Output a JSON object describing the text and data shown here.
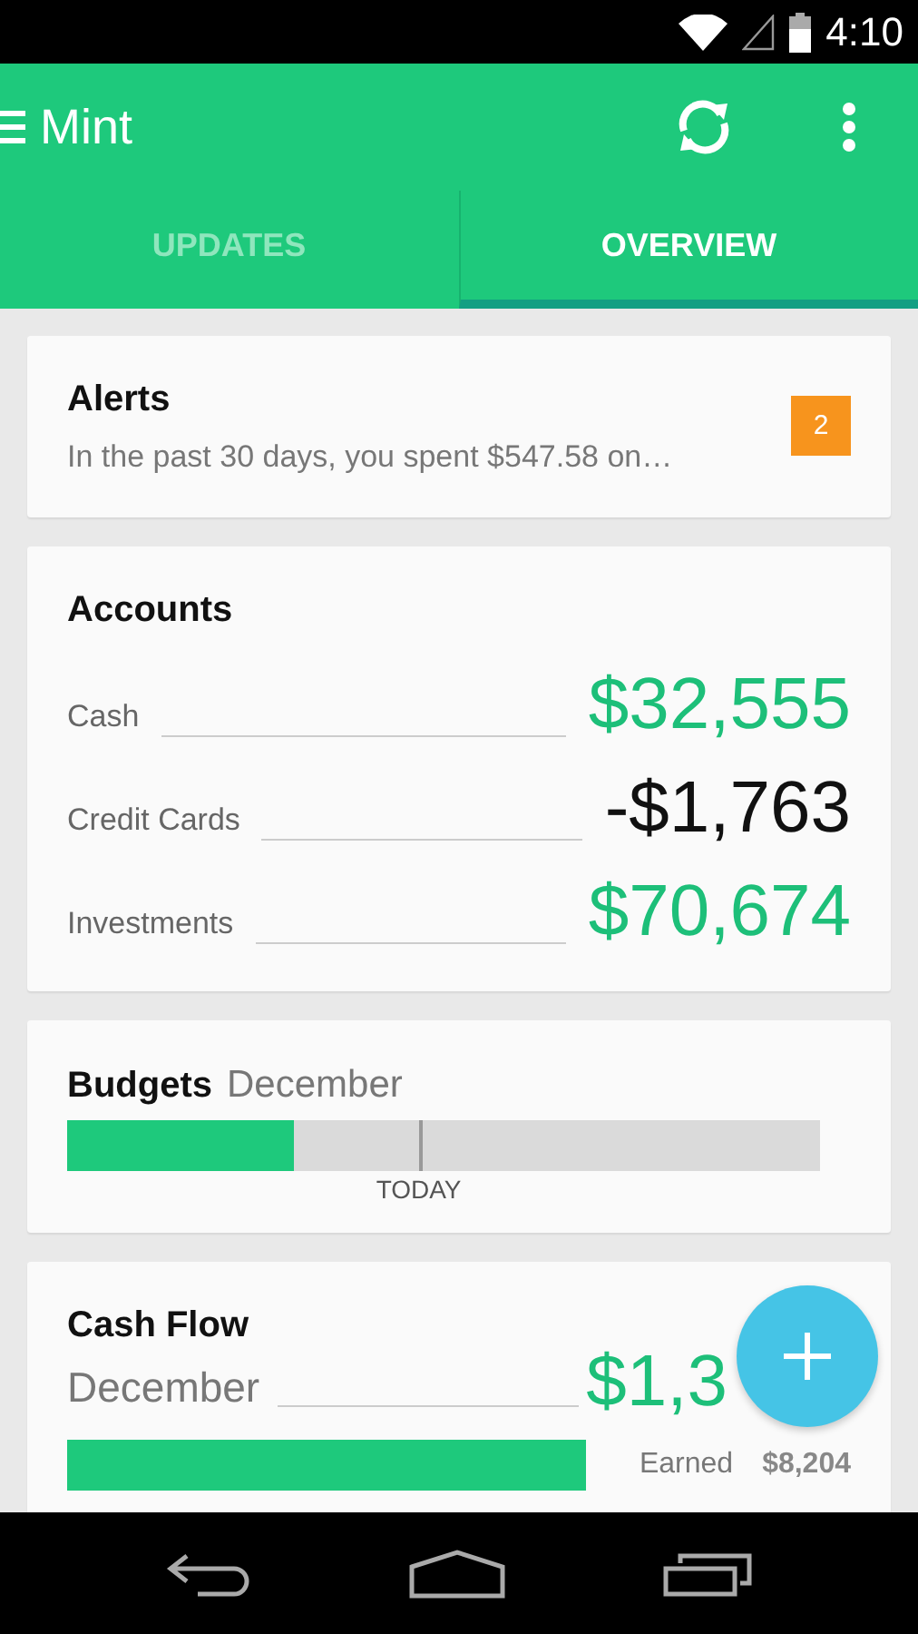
{
  "status_bar": {
    "time": "4:10"
  },
  "app_bar": {
    "title": "Mint"
  },
  "tabs": [
    {
      "label": "UPDATES",
      "selected": false
    },
    {
      "label": "OVERVIEW",
      "selected": true
    }
  ],
  "alerts": {
    "title": "Alerts",
    "message": "In the past 30 days, you spent $547.58 on…",
    "count": "2"
  },
  "accounts": {
    "title": "Accounts",
    "rows": [
      {
        "name": "Cash",
        "amount": "$32,555",
        "color": "#1dbf79"
      },
      {
        "name": "Credit Cards",
        "amount": "-$1,763",
        "color": "#111111"
      },
      {
        "name": "Investments",
        "amount": "$70,674",
        "color": "#1dbf79"
      }
    ]
  },
  "budgets": {
    "title": "Budgets",
    "period": "December",
    "level": 0.3,
    "today": {
      "label": "TODAY",
      "level": 0.467
    }
  },
  "cash_flow": {
    "title": "Cash Flow",
    "period": "December",
    "amount": "$1,3",
    "earned_label": "Earned",
    "earned": "$8,204"
  }
}
